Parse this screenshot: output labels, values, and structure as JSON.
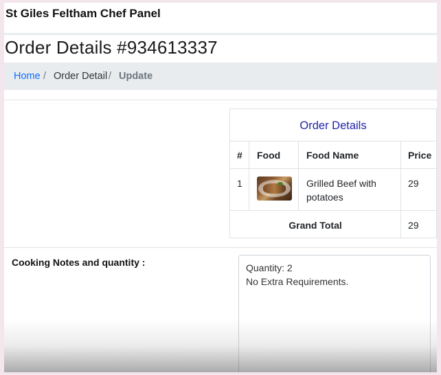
{
  "navbar": {
    "brand": "St Giles Feltham Chef Panel"
  },
  "page": {
    "title": "Order Details #934613337"
  },
  "breadcrumb": {
    "home": "Home",
    "separator": "/",
    "detail": "Order Detail",
    "active": "Update"
  },
  "order_table": {
    "caption": "Order Details",
    "headers": {
      "num": "#",
      "food": "Food",
      "food_name": "Food Name",
      "price": "Price"
    },
    "rows": [
      {
        "num": "1",
        "food_image_icon": "food-photo-icon",
        "food_name_line1": "Grilled Beef with",
        "food_name_line2": "potatoes",
        "price": "29"
      }
    ],
    "footer": {
      "label": "Grand Total",
      "value": "29"
    }
  },
  "notes": {
    "label": "Cooking Notes and quantity :",
    "line1": "Quantity: 2",
    "line2": "No Extra Requirements."
  },
  "colors": {
    "link": "#0d6efd",
    "caption": "#2222aa",
    "breadcrumb_bg": "#e9ecef"
  }
}
